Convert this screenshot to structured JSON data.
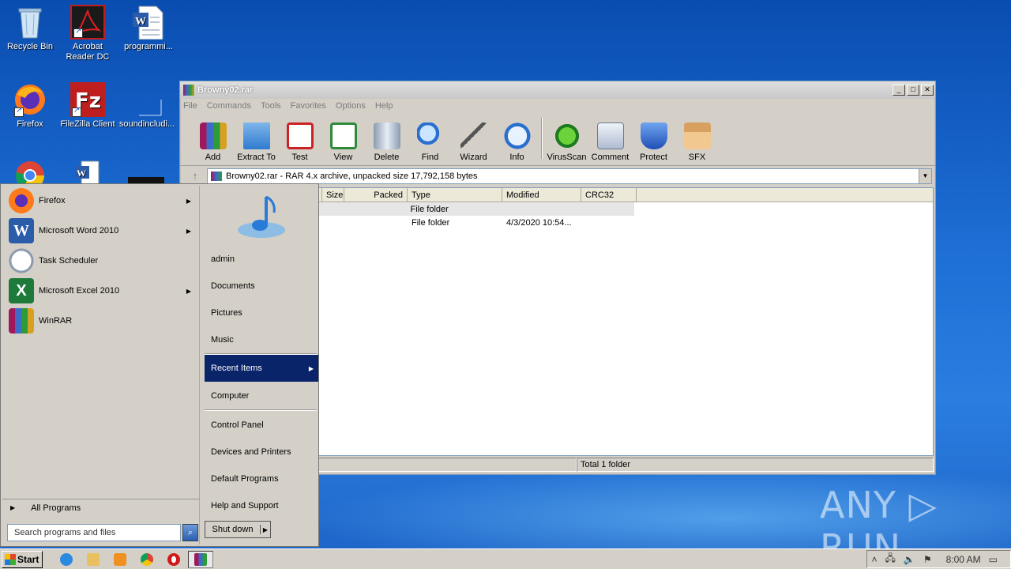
{
  "desktop": {
    "icons": [
      {
        "label": "Recycle Bin"
      },
      {
        "label": "Acrobat Reader DC"
      },
      {
        "label": "programmi..."
      },
      {
        "label": "Firefox"
      },
      {
        "label": "FileZilla Client"
      },
      {
        "label": "soundincludi..."
      }
    ],
    "watermark": "ANY RUN"
  },
  "winrar": {
    "title": "Browny02.rar",
    "menu": [
      "File",
      "Commands",
      "Tools",
      "Favorites",
      "Options",
      "Help"
    ],
    "toolbar": [
      "Add",
      "Extract To",
      "Test",
      "View",
      "Delete",
      "Find",
      "Wizard",
      "Info",
      "VirusScan",
      "Comment",
      "Protect",
      "SFX"
    ],
    "address": "Browny02.rar - RAR 4.x archive, unpacked size 17,792,158 bytes",
    "columns": [
      "Size",
      "Packed",
      "Type",
      "Modified",
      "CRC32"
    ],
    "rows": [
      {
        "size": "",
        "packed": "",
        "type": "File folder",
        "modified": "",
        "crc": ""
      },
      {
        "size": "",
        "packed": "",
        "type": "File folder",
        "modified": "4/3/2020 10:54...",
        "crc": ""
      }
    ],
    "status_right": "Total 1 folder"
  },
  "startmenu": {
    "programs": [
      {
        "label": "Firefox",
        "has_arrow": true
      },
      {
        "label": "Microsoft Word 2010",
        "has_arrow": true
      },
      {
        "label": "Task Scheduler",
        "has_arrow": false
      },
      {
        "label": "Microsoft Excel 2010",
        "has_arrow": true
      },
      {
        "label": "WinRAR",
        "has_arrow": false
      }
    ],
    "all_programs": "All Programs",
    "search_placeholder": "Search programs and files",
    "right_items": [
      "admin",
      "Documents",
      "Pictures",
      "Music",
      "Recent Items",
      "Computer",
      "Control Panel",
      "Devices and Printers",
      "Default Programs",
      "Help and Support"
    ],
    "shutdown": "Shut down"
  },
  "taskbar": {
    "start": "Start",
    "clock": "8:00 AM"
  }
}
